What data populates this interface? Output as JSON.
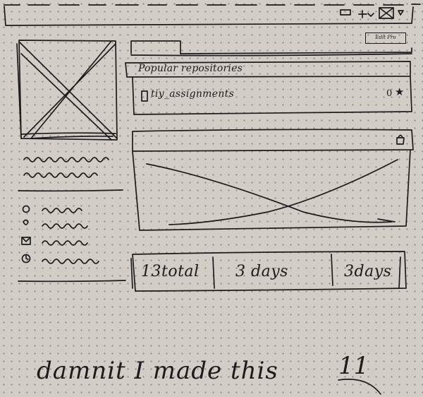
{
  "header": {
    "notifications_icon": "bell-icon",
    "new_icon": "plus-icon",
    "profile_icon": "avatar-placeholder-icon",
    "menu_icon": "dropdown-caret-icon"
  },
  "edit_button": {
    "label": "Edit Pro"
  },
  "tabs": {
    "first_tab_label": "",
    "second_tab_label": ""
  },
  "popular_repos": {
    "title": "Popular repositories",
    "items": [
      {
        "icon": "repo-icon",
        "name": "tiy_assignments",
        "stars": "0",
        "star_icon": "star-icon"
      }
    ]
  },
  "contributions": {
    "lock_icon": "lock-icon",
    "image_icon": "image-placeholder-icon"
  },
  "profile": {
    "avatar_icon": "image-placeholder-icon",
    "details_icons": [
      "location-icon",
      "map-pin-icon",
      "mail-icon",
      "clock-icon"
    ]
  },
  "stats": {
    "total": "13total",
    "longest_streak": "3 days",
    "current_streak": "3days"
  },
  "caption": {
    "text": "damnit I made this",
    "number": "11"
  }
}
